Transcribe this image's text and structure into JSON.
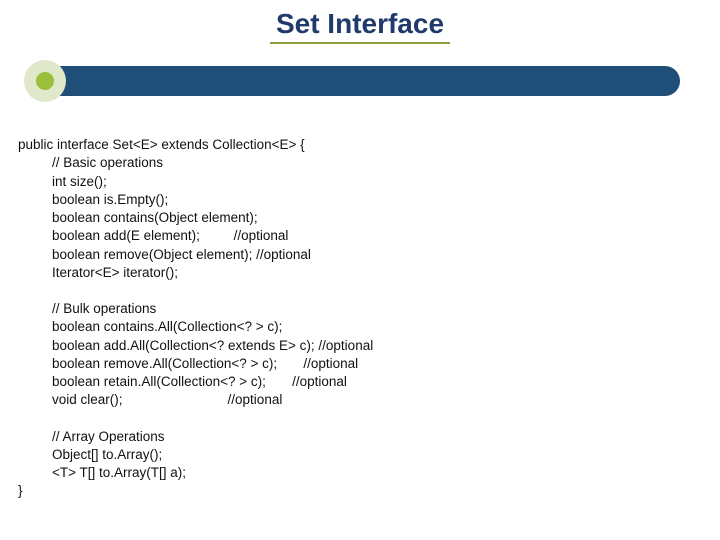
{
  "title": "Set Interface",
  "code": {
    "decl": "public interface Set<E> extends Collection<E> {",
    "basic_comment": "// Basic operations",
    "size": "int size();",
    "isEmpty": "boolean is.Empty();",
    "contains": "boolean contains(Object element);",
    "add": "boolean add(E element);         //optional",
    "remove": "boolean remove(Object element); //optional",
    "iterator": "Iterator<E> iterator();",
    "bulk_comment": "// Bulk operations",
    "containsAll": "boolean contains.All(Collection<? > c);",
    "addAll": "boolean add.All(Collection<? extends E> c); //optional",
    "removeAll": "boolean remove.All(Collection<? > c);       //optional",
    "retainAll": "boolean retain.All(Collection<? > c);       //optional",
    "clear": "void clear();                            //optional",
    "array_comment": "// Array Operations",
    "toArray1": "Object[] to.Array();",
    "toArray2": "<T> T[] to.Array(T[] a);",
    "close": "}"
  }
}
